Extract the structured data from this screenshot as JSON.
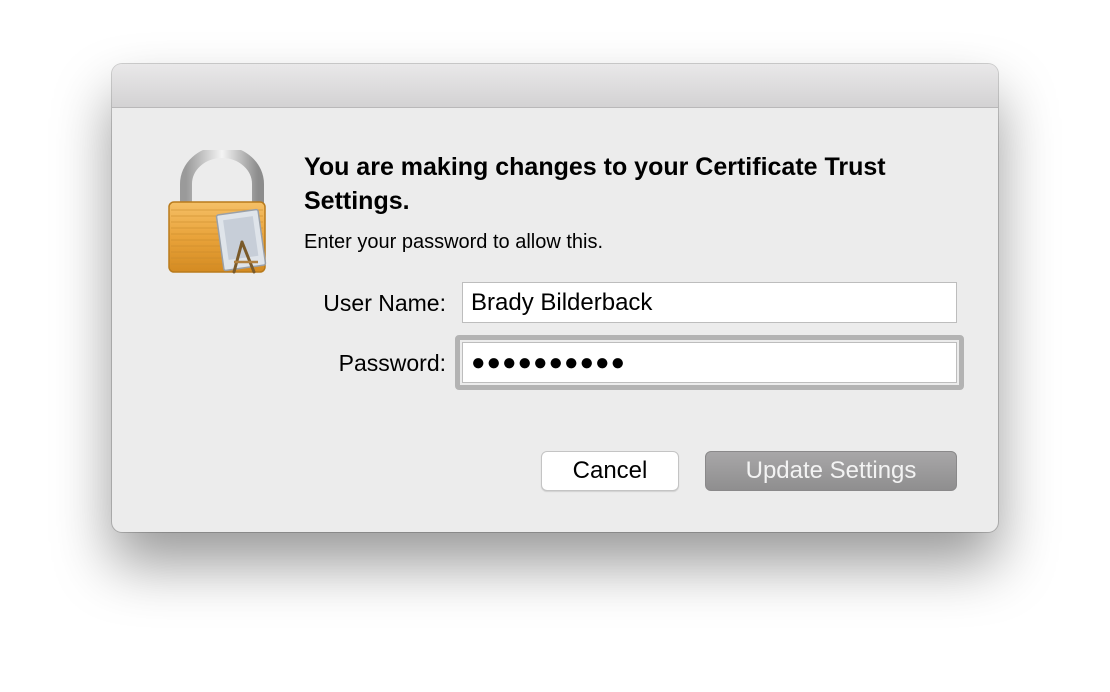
{
  "dialog": {
    "heading": "You are making changes to your Certificate Trust Settings.",
    "subtext": "Enter your password to allow this.",
    "icon": "lock-icon"
  },
  "form": {
    "username_label": "User Name:",
    "username_value": "Brady Bilderback",
    "password_label": "Password:",
    "password_value": "●●●●●●●●●●"
  },
  "buttons": {
    "cancel_label": "Cancel",
    "update_label": "Update Settings"
  },
  "colors": {
    "dialog_bg": "#ececec",
    "lock_gold": "#e9a33a",
    "primary_button_disabled": "#9a999a"
  }
}
